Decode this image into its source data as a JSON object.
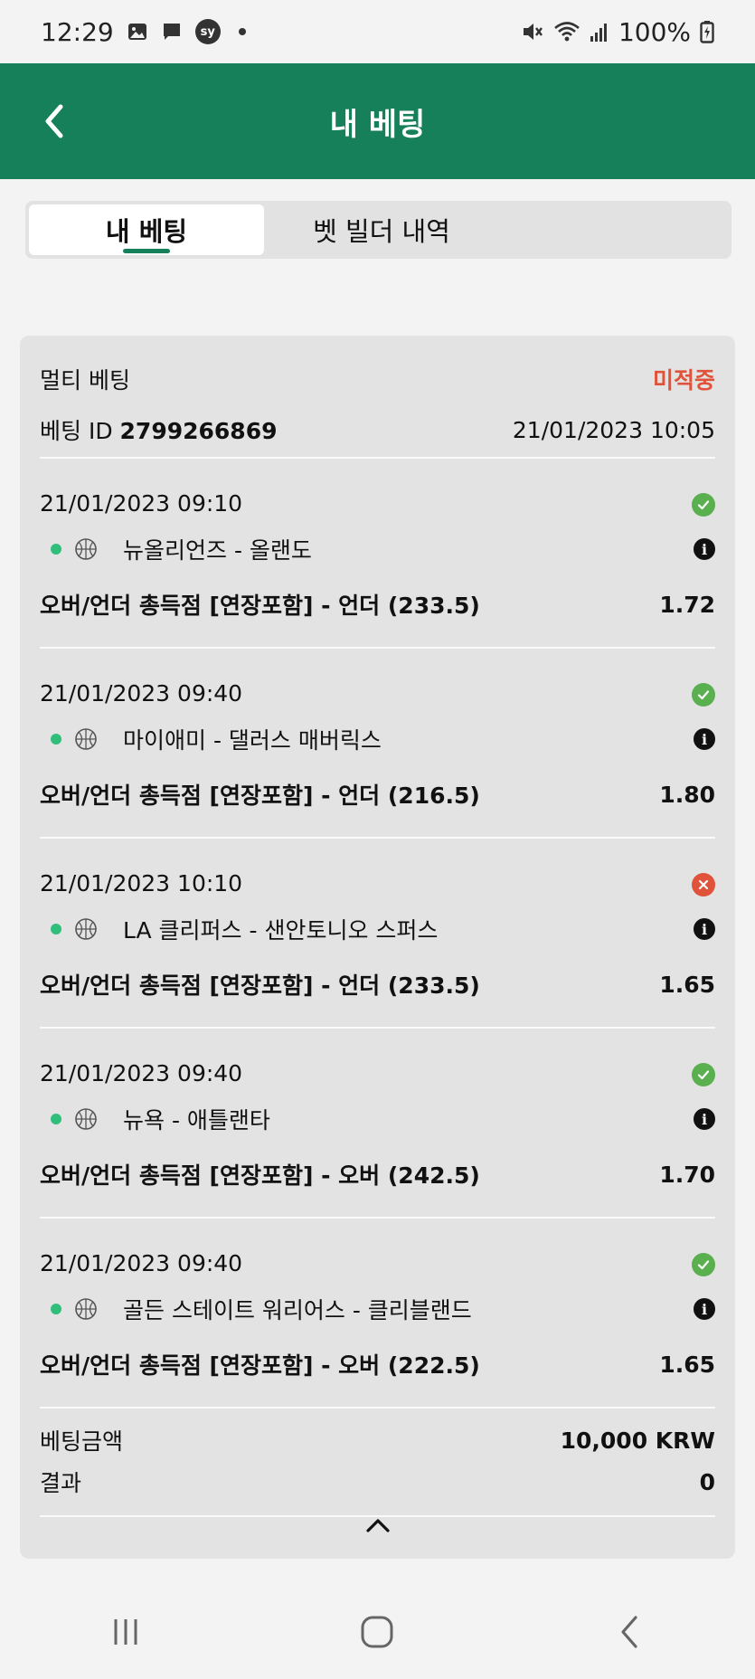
{
  "status_bar": {
    "time": "12:29",
    "sy_label": "sy",
    "battery": "100%",
    "icons_left": [
      "gallery-icon",
      "message-icon",
      "sy-icon",
      "dot-icon"
    ],
    "icons_right": [
      "mute-icon",
      "wifi-icon",
      "signal-icon",
      "battery-icon"
    ]
  },
  "header": {
    "title": "내 베팅",
    "back_icon": "chevron-left-icon"
  },
  "tabs": [
    {
      "label": "내 베팅",
      "active": true
    },
    {
      "label": "벳 빌더 내역",
      "active": false
    }
  ],
  "bet": {
    "type": "멀티 베팅",
    "status": "미적중",
    "id_label": "베팅 ID",
    "id": "2799266869",
    "placed_at": "21/01/2023 10:05",
    "selections": [
      {
        "datetime": "21/01/2023 09:10",
        "result": "win",
        "match": "뉴올리언즈 - 올랜도",
        "market": "오버/언더 총득점 [연장포함] - 언더 (233.5)",
        "odds": "1.72"
      },
      {
        "datetime": "21/01/2023 09:40",
        "result": "win",
        "match": "마이애미 - 댈러스 매버릭스",
        "market": "오버/언더 총득점 [연장포함] - 언더 (216.5)",
        "odds": "1.80"
      },
      {
        "datetime": "21/01/2023 10:10",
        "result": "lose",
        "match": "LA 클리퍼스 - 샌안토니오 스퍼스",
        "market": "오버/언더 총득점 [연장포함] - 언더 (233.5)",
        "odds": "1.65"
      },
      {
        "datetime": "21/01/2023 09:40",
        "result": "win",
        "match": "뉴욕 - 애틀랜타",
        "market": "오버/언더 총득점 [연장포함] - 오버 (242.5)",
        "odds": "1.70"
      },
      {
        "datetime": "21/01/2023 09:40",
        "result": "win",
        "match": "골든 스테이트 워리어스 - 클리블랜드",
        "market": "오버/언더 총득점 [연장포함] - 오버 (222.5)",
        "odds": "1.65"
      }
    ],
    "stake_label": "베팅금액",
    "stake": "10,000 KRW",
    "result_label": "결과",
    "result_value": "0"
  },
  "colors": {
    "brand": "#16805a",
    "lose": "#e0533a",
    "win": "#5aaf4f",
    "live_dot": "#2fbf7a"
  },
  "nav": [
    "recents-icon",
    "home-icon",
    "back-icon"
  ]
}
